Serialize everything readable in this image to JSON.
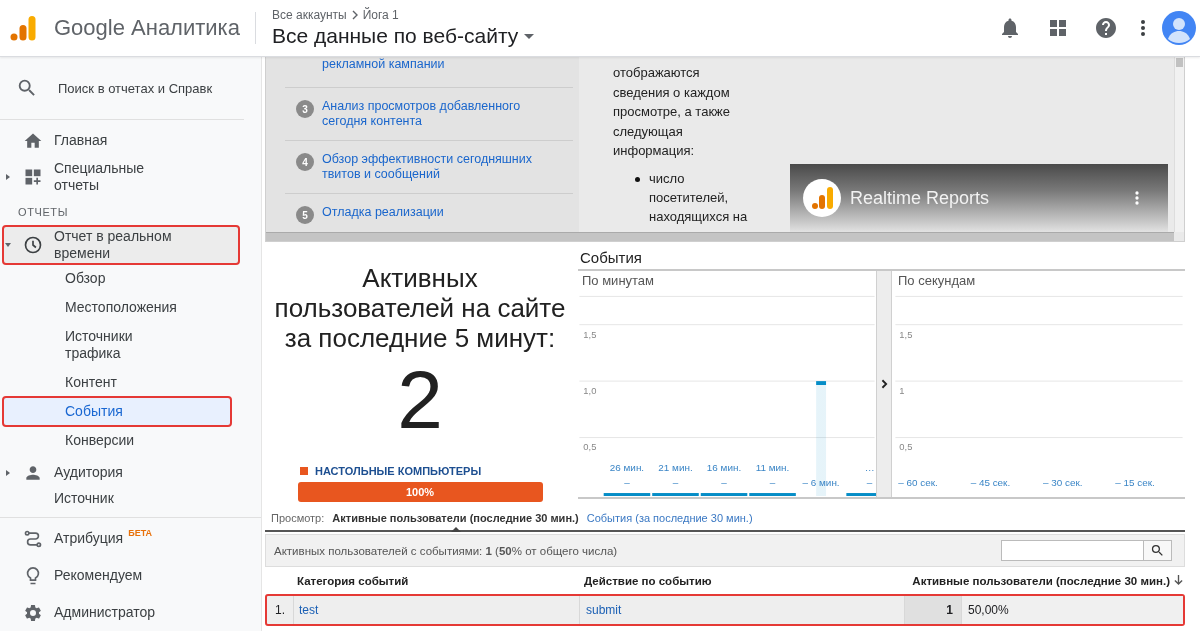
{
  "header": {
    "product": "Google Аналитика",
    "breadcrumb": [
      "Все аккаунты",
      "Йога 1"
    ],
    "view": "Все данные по веб-сайту"
  },
  "sidebar": {
    "search": {
      "placeholder": "Поиск в отчетах и Справк"
    },
    "nav": [
      {
        "kind": "item",
        "label": "Главная",
        "highlighted": false
      },
      {
        "kind": "item",
        "label": "Специальные отчеты",
        "expanded": false,
        "highlighted": false
      },
      {
        "kind": "section",
        "label": "ОТЧЕТЫ"
      },
      {
        "kind": "item",
        "label": "Отчет в реальном времени",
        "expanded": true,
        "highlighted": true,
        "children": [
          {
            "label": "Обзор",
            "selected": false,
            "highlighted": false
          },
          {
            "label": "Местоположения",
            "selected": false,
            "highlighted": false
          },
          {
            "label": "Источники трафика",
            "selected": false,
            "highlighted": false
          },
          {
            "label": "Контент",
            "selected": false,
            "highlighted": false
          },
          {
            "label": "События",
            "selected": true,
            "highlighted": true
          },
          {
            "label": "Конверсии",
            "selected": false,
            "highlighted": false
          }
        ]
      },
      {
        "kind": "item",
        "label": "Аудитория",
        "expanded": false,
        "highlighted": false
      },
      {
        "kind": "item",
        "label": "Источник",
        "highlighted": false
      }
    ],
    "footer": [
      {
        "label": "Атрибуция",
        "badge": "БЕТА"
      },
      {
        "label": "Рекомендуем"
      },
      {
        "label": "Администратор"
      }
    ]
  },
  "guide": {
    "steps": [
      {
        "text": "рекламной кампании"
      },
      {
        "number": "3",
        "text": "Анализ просмотров добавленного сегодня контента"
      },
      {
        "number": "4",
        "text": "Обзор эффективности сегодняшних твитов и сообщений"
      },
      {
        "number": "5",
        "text": "Отладка реализации"
      }
    ],
    "description": "отображаются сведения о каждом просмотре, а также следующая информация:",
    "bullets": [
      "число посетителей, находящихся на"
    ],
    "video": {
      "title": "Realtime Reports"
    }
  },
  "active_users": {
    "title": "Активных пользователей на сайте за последние 5 минут:",
    "count": "2",
    "devices": [
      {
        "label": "НАСТОЛЬНЫЕ КОМПЬЮТЕРЫ",
        "color": "#e8561f",
        "share": "100%",
        "level": 1
      }
    ]
  },
  "events": {
    "title": "События",
    "panels": [
      {
        "chart_data": {
          "type": "bar",
          "title": "По минутам",
          "grid": true,
          "ylim": [
            0,
            1.75
          ],
          "yticks": [
            {
              "value": 0.5,
              "label": "0,5"
            },
            {
              "value": 1,
              "label": "1,0"
            },
            {
              "value": 1.5,
              "label": "1,5"
            }
          ],
          "categories": [
            "26 мин.\n–",
            "21 мин.\n–",
            "16 мин.\n–",
            "11 мин.\n–",
            "– 6 мин.",
            "…\n–"
          ],
          "series": [
            {
              "color": "#058dc7",
              "values": [
                0,
                0,
                0,
                0,
                1,
                0
              ]
            }
          ]
        }
      },
      {
        "chart_data": {
          "type": "bar",
          "title": "По секундам",
          "grid": true,
          "ylim": [
            0,
            1.75
          ],
          "yticks": [
            {
              "value": 0.5,
              "label": "0,5"
            },
            {
              "value": 1,
              "label": "1"
            },
            {
              "value": 1.5,
              "label": "1,5"
            }
          ],
          "categories": [
            "– 60 сек.",
            "– 45 сек.",
            "– 30 сек.",
            "– 15 сек."
          ],
          "series": [
            {
              "color": "#058dc7",
              "values": [
                null,
                null,
                null,
                null
              ]
            }
          ]
        }
      }
    ]
  },
  "view_tabs": {
    "label": "Просмотр:",
    "tabs": [
      {
        "label": "Активные пользователи (последние 30 мин.)",
        "selected": true
      },
      {
        "label": "События (за последние 30 мин.)",
        "selected": false
      }
    ]
  },
  "table": {
    "summary": "Активных пользователей с событиями: **1** (**50**% от общего числа)",
    "columns": [
      "Категория событий",
      "Действие по событию",
      "Активные пользователи (последние 30 мин.)"
    ],
    "rows": [
      {
        "index": "1.",
        "category": "test",
        "action": "submit",
        "users": "1",
        "share": "50,00%",
        "highlighted": true
      }
    ]
  }
}
